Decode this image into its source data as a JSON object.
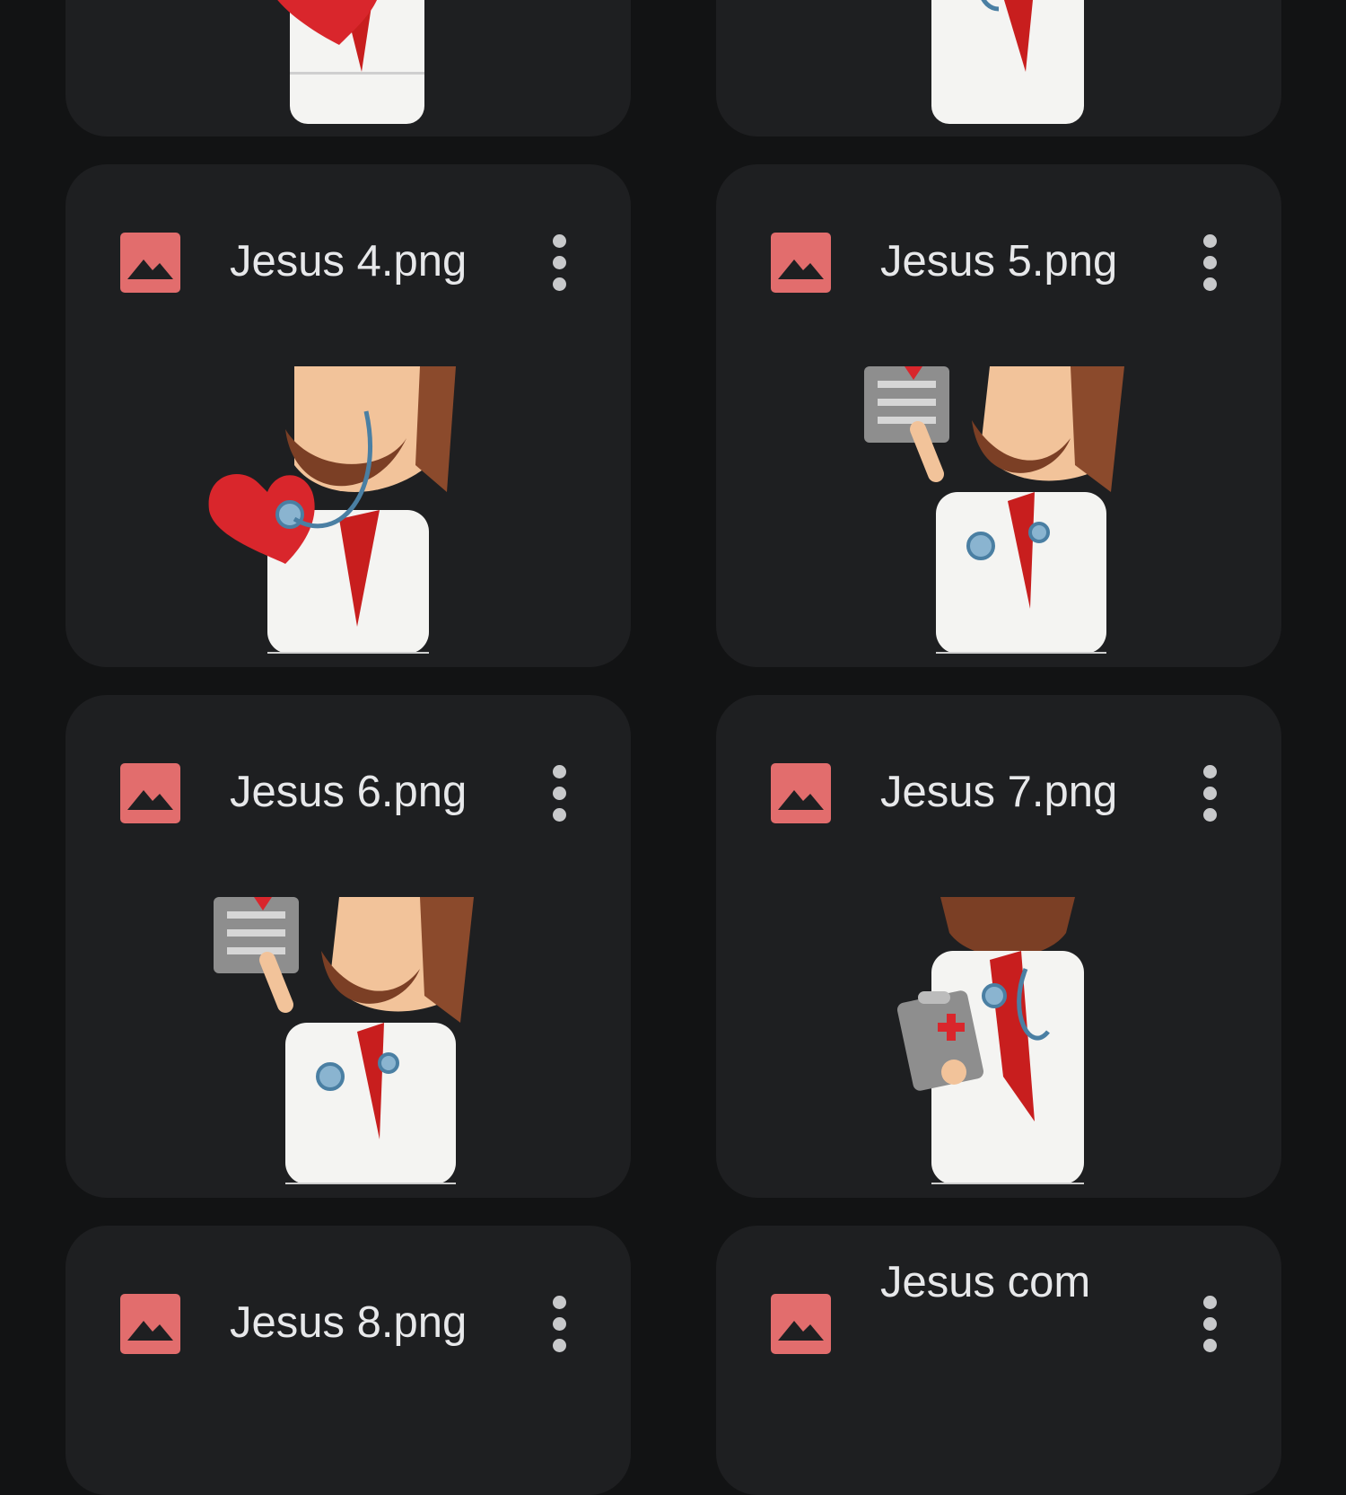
{
  "files": [
    {
      "name": "Jesus 4.png",
      "icon": "image-icon",
      "thumbnail": "doctor-holding-heart-thumbnail"
    },
    {
      "name": "Jesus 5.png",
      "icon": "image-icon",
      "thumbnail": "doctor-holding-xray-thumbnail"
    },
    {
      "name": "Jesus 6.png",
      "icon": "image-icon",
      "thumbnail": "doctor-holding-xray-thumbnail"
    },
    {
      "name": "Jesus 7.png",
      "icon": "image-icon",
      "thumbnail": "doctor-holding-clipboard-thumbnail"
    },
    {
      "name": "Jesus 8.png",
      "icon": "image-icon"
    },
    {
      "name": "Jesus com",
      "icon": "image-icon"
    }
  ],
  "colors": {
    "background": "#121314",
    "card": "#1e1f21",
    "image_icon": "#e26d6d",
    "text": "#e7e8ea"
  }
}
